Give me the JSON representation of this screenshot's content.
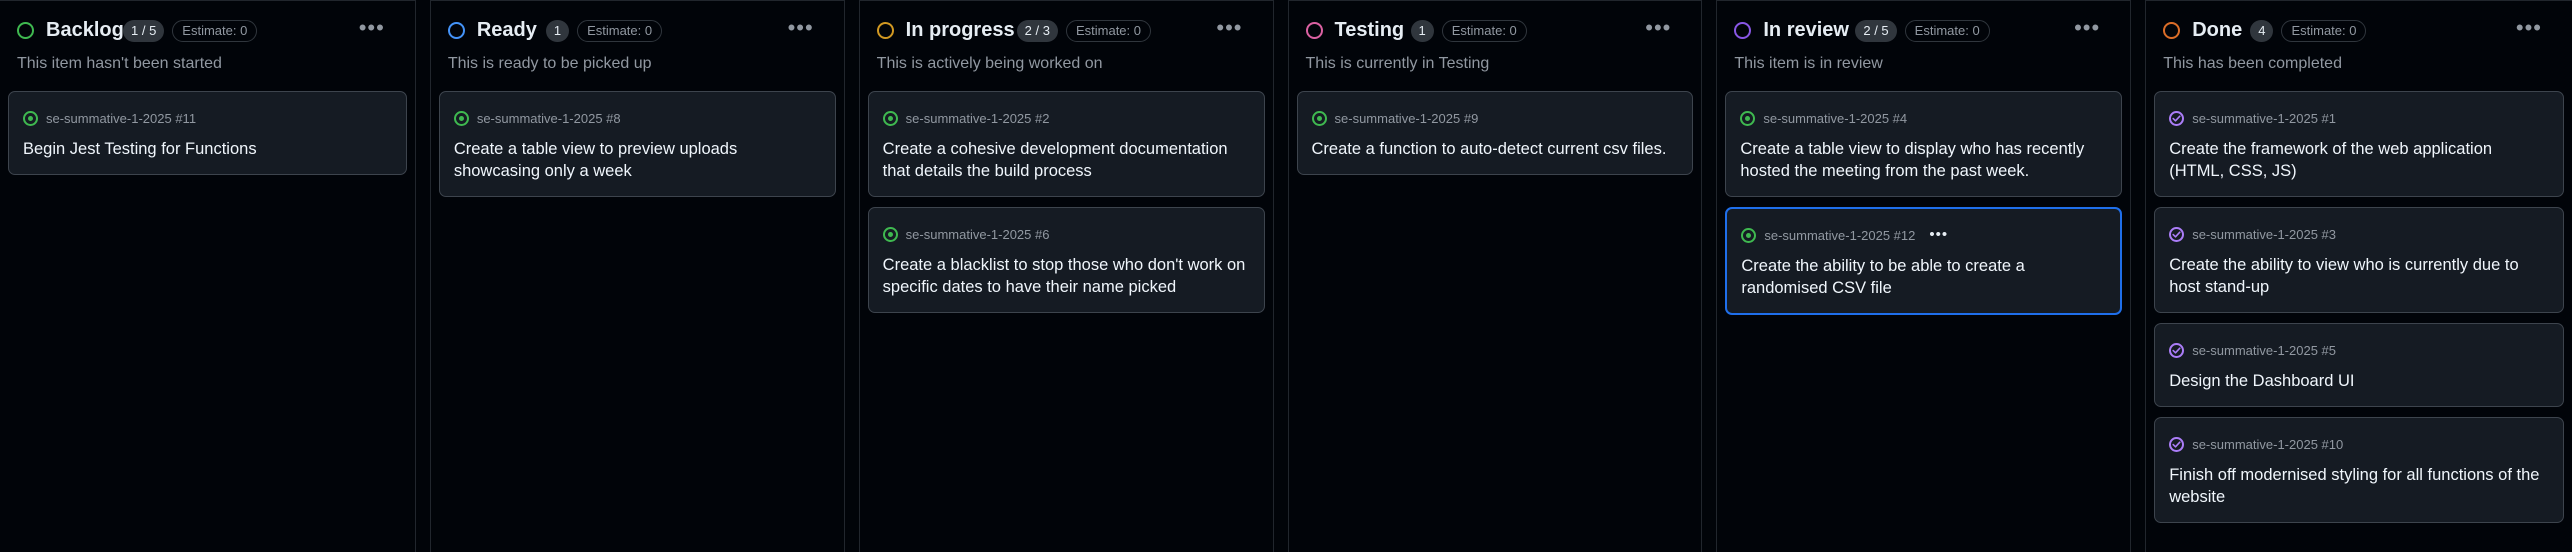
{
  "colors": {
    "backlog": "#3fb950",
    "ready": "#4493f8",
    "in_progress": "#d29922",
    "testing": "#db61a2",
    "in_review": "#8957e5",
    "done": "#db6d28",
    "issue_open": "#3fb950",
    "issue_done": "#ab7df8",
    "selected_border": "#1f6feb"
  },
  "columns": [
    {
      "title": "Backlog",
      "count": "1 / 5",
      "estimate": "Estimate: 0",
      "description": "This item hasn't been started",
      "menu_icon": "more-horizontal-icon",
      "cards": [
        {
          "meta": "se-summative-1-2025 #11",
          "title": "Begin Jest Testing for Functions",
          "state": "open"
        }
      ]
    },
    {
      "title": "Ready",
      "count": "1",
      "estimate": "Estimate: 0",
      "description": "This is ready to be picked up",
      "menu_icon": "more-horizontal-icon",
      "cards": [
        {
          "meta": "se-summative-1-2025 #8",
          "title": "Create a table view to preview uploads showcasing only a week",
          "state": "open"
        }
      ]
    },
    {
      "title": "In progress",
      "count": "2 / 3",
      "estimate": "Estimate: 0",
      "description": "This is actively being worked on",
      "menu_icon": "more-horizontal-icon",
      "cards": [
        {
          "meta": "se-summative-1-2025 #2",
          "title": "Create a cohesive development documentation that details the build process",
          "state": "open"
        },
        {
          "meta": "se-summative-1-2025 #6",
          "title": "Create a blacklist to stop those who don't work on specific dates to have their name picked",
          "state": "open"
        }
      ]
    },
    {
      "title": "Testing",
      "count": "1",
      "estimate": "Estimate: 0",
      "description": "This is currently in Testing",
      "menu_icon": "more-horizontal-icon",
      "cards": [
        {
          "meta": "se-summative-1-2025 #9",
          "title": "Create a function to auto-detect current csv files.",
          "state": "open"
        }
      ]
    },
    {
      "title": "In review",
      "count": "2 / 5",
      "estimate": "Estimate: 0",
      "description": "This item is in review",
      "menu_icon": "more-horizontal-icon",
      "cards": [
        {
          "meta": "se-summative-1-2025 #4",
          "title": "Create a table view to display who has recently hosted the meeting from the past week.",
          "state": "open"
        },
        {
          "meta": "se-summative-1-2025 #12",
          "title": "Create the ability to be able to create a randomised CSV file",
          "state": "open",
          "selected": true,
          "menu": "•••"
        }
      ]
    },
    {
      "title": "Done",
      "count": "4",
      "estimate": "Estimate: 0",
      "description": "This has been completed",
      "menu_icon": "more-horizontal-icon",
      "cards": [
        {
          "meta": "se-summative-1-2025 #1",
          "title": "Create the framework of the web application (HTML, CSS, JS)",
          "state": "done"
        },
        {
          "meta": "se-summative-1-2025 #3",
          "title": "Create the ability to view who is currently due to host stand-up",
          "state": "done"
        },
        {
          "meta": "se-summative-1-2025 #5",
          "title": "Design the Dashboard UI",
          "state": "done"
        },
        {
          "meta": "se-summative-1-2025 #10",
          "title": "Finish off modernised styling for all functions of the website",
          "state": "done"
        }
      ]
    }
  ]
}
